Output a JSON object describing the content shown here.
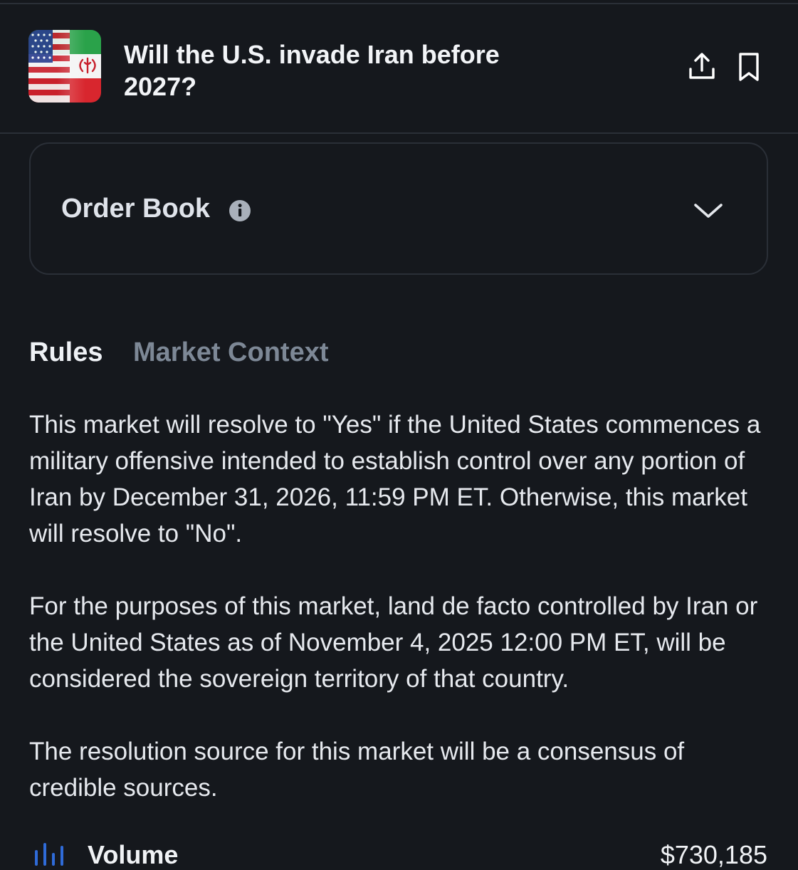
{
  "header": {
    "title": "Will the U.S. invade Iran before 2027?",
    "icon": "us-iran-flag-icon",
    "actions": [
      "share-icon",
      "bookmark-icon"
    ]
  },
  "order_book": {
    "label": "Order Book",
    "info_icon": "info-icon",
    "toggle_icon": "chevron-down-icon"
  },
  "tabs": [
    {
      "label": "Rules",
      "active": true
    },
    {
      "label": "Market Context",
      "active": false
    }
  ],
  "rules": {
    "paragraphs": [
      "This market will resolve to \"Yes\" if the United States commences a military offensive intended to establish control over any portion of Iran by December 31, 2026, 11:59 PM ET. Otherwise, this market will resolve to \"No\".",
      "For the purposes of this market, land de facto controlled by Iran or the United States as of November 4, 2025 12:00 PM ET, will be considered the sovereign territory of that country.",
      "The resolution source for this market will be a consensus of credible sources."
    ]
  },
  "volume": {
    "label": "Volume",
    "value": "$730,185",
    "icon": "bar-chart-icon"
  },
  "colors": {
    "background": "#15181d",
    "border": "#2a2f37",
    "text_primary": "#e6e9ee",
    "text_muted": "#7d8896",
    "accent_blue": "#2f6bd8"
  }
}
